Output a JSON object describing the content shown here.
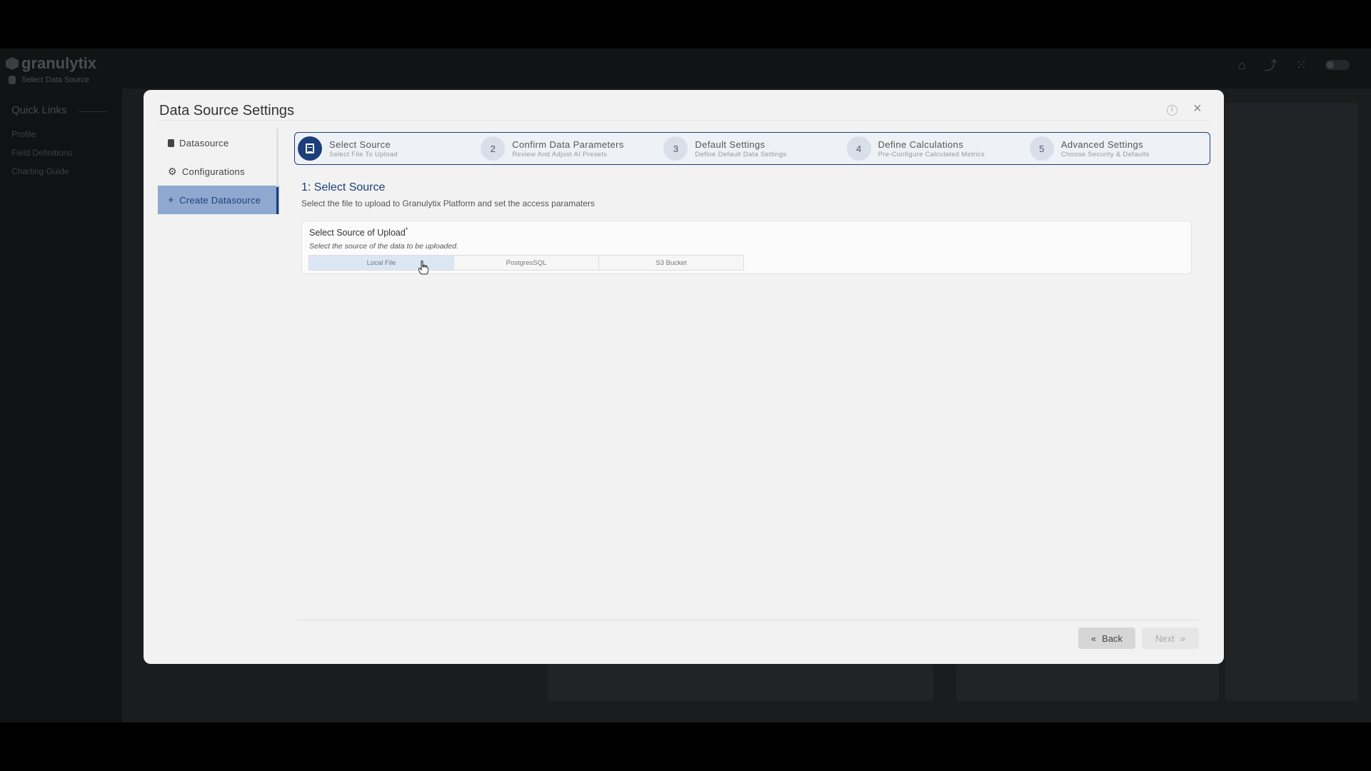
{
  "app": {
    "logo": "granulytix",
    "breadcrumb": "Select Data Source",
    "quick_links_title": "Quick Links",
    "quick_links": [
      "Profile",
      "Field Definitions",
      "Charting Guide"
    ],
    "top_icons": [
      "home-icon",
      "chart-icon",
      "grid-icon",
      "theme-toggle"
    ]
  },
  "modal": {
    "title": "Data Source Settings",
    "nav": [
      {
        "label": "Datasource",
        "icon": "database-icon"
      },
      {
        "label": "Configurations",
        "icon": "gear-icon"
      },
      {
        "label": "Create Datasource",
        "icon": "plus-icon",
        "active": true
      }
    ],
    "steps": [
      {
        "num": "1",
        "title": "Select Source",
        "sub": "Select File To Upload",
        "active": true
      },
      {
        "num": "2",
        "title": "Confirm Data Parameters",
        "sub": "Review And Adjust AI Presets"
      },
      {
        "num": "3",
        "title": "Default Settings",
        "sub": "Define Default Data Settings"
      },
      {
        "num": "4",
        "title": "Define Calculations",
        "sub": "Pre-Configure Calculated Metrics"
      },
      {
        "num": "5",
        "title": "Advanced Settings",
        "sub": "Choose Security & Defaults"
      }
    ],
    "section_title": "1: Select Source",
    "section_desc": "Select the file to upload to Granulytix Platform and set the access paramaters",
    "source": {
      "label": "Select Source of Upload",
      "required_mark": "*",
      "hint": "Select the source of the data to be uploaded.",
      "options": [
        "Local File",
        "PostgresSQL",
        "S3 Bucket"
      ],
      "selected": "Local File"
    },
    "back_label": "Back",
    "next_label": "Next"
  },
  "colors": {
    "accent": "#1c3f7b",
    "stepper_bg": "#eef1f6",
    "selected_option": "#dbe6f5"
  }
}
